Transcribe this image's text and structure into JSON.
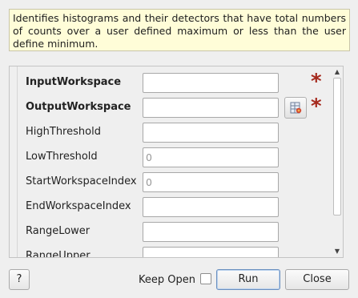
{
  "description": "Identifies histograms and their detectors that have total numbers of counts over a user defined maximum or less than the user define minimum.",
  "properties": [
    {
      "label": "InputWorkspace",
      "bold": true,
      "value": "",
      "placeholder": "",
      "required": true,
      "browse": false
    },
    {
      "label": "OutputWorkspace",
      "bold": true,
      "value": "",
      "placeholder": "",
      "required": true,
      "browse": true
    },
    {
      "label": "HighThreshold",
      "bold": false,
      "value": "",
      "placeholder": "",
      "required": false,
      "browse": false
    },
    {
      "label": "LowThreshold",
      "bold": false,
      "value": "",
      "placeholder": "0",
      "required": false,
      "browse": false
    },
    {
      "label": "StartWorkspaceIndex",
      "bold": false,
      "value": "",
      "placeholder": "0",
      "required": false,
      "browse": false
    },
    {
      "label": "EndWorkspaceIndex",
      "bold": false,
      "value": "",
      "placeholder": "",
      "required": false,
      "browse": false
    },
    {
      "label": "RangeLower",
      "bold": false,
      "value": "",
      "placeholder": "",
      "required": false,
      "browse": false
    },
    {
      "label": "RangeUpper",
      "bold": false,
      "value": "",
      "placeholder": "",
      "required": false,
      "browse": false
    }
  ],
  "scroll": {
    "position_fraction": 0.0,
    "visible_fraction": 0.82
  },
  "required_marker": "*",
  "buttons": {
    "help": "?",
    "keep_open": "Keep Open",
    "run": "Run",
    "close": "Close"
  },
  "keep_open_checked": false,
  "colors": {
    "description_bg": "#fffdd8",
    "required_star": "#a52a1e"
  }
}
